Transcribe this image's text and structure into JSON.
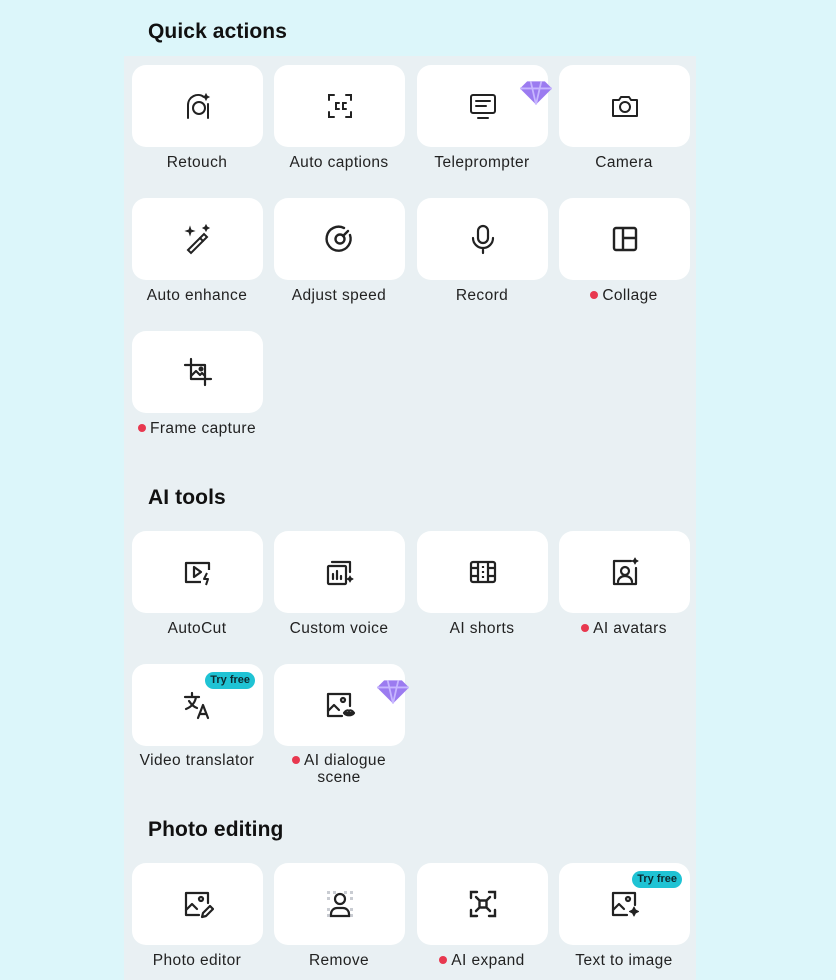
{
  "colors": {
    "background": "#dcf6fa",
    "panel": "#e9f0f3",
    "tile": "#ffffff",
    "new_dot": "#e8384f",
    "try_free_badge": "#1fc3d4",
    "premium_gem": "#9b7bf0"
  },
  "sections": {
    "quick_actions": {
      "title": "Quick actions",
      "items": [
        {
          "label": "Retouch",
          "icon": "retouch-face-icon"
        },
        {
          "label": "Auto captions",
          "icon": "captions-icon"
        },
        {
          "label": "Teleprompter",
          "icon": "teleprompter-icon",
          "badge": "premium"
        },
        {
          "label": "Camera",
          "icon": "camera-icon"
        },
        {
          "label": "Auto enhance",
          "icon": "magic-wand-icon"
        },
        {
          "label": "Adjust speed",
          "icon": "speed-dial-icon"
        },
        {
          "label": "Record",
          "icon": "microphone-icon"
        },
        {
          "label": "Collage",
          "icon": "collage-icon",
          "new": true
        },
        {
          "label": "Frame capture",
          "icon": "frame-crop-icon",
          "new": true
        }
      ]
    },
    "ai_tools": {
      "title": "AI tools",
      "items": [
        {
          "label": "AutoCut",
          "icon": "autocut-play-icon"
        },
        {
          "label": "Custom voice",
          "icon": "voice-waveform-icon"
        },
        {
          "label": "AI shorts",
          "icon": "film-strip-icon"
        },
        {
          "label": "AI avatars",
          "icon": "avatar-sparkle-icon",
          "new": true
        },
        {
          "label": "Video translator",
          "icon": "translate-icon",
          "badge_text": "Try free"
        },
        {
          "label": "AI dialogue scene",
          "label_line1": "AI dialogue",
          "label_line2": "scene",
          "icon": "image-lips-icon",
          "new": true,
          "badge": "premium"
        }
      ]
    },
    "photo_editing": {
      "title": "Photo editing",
      "items": [
        {
          "label": "Photo editor",
          "icon": "image-edit-icon"
        },
        {
          "label": "Remove",
          "icon": "remove-person-icon"
        },
        {
          "label": "AI expand",
          "icon": "expand-focus-icon",
          "new": true
        },
        {
          "label": "Text to image",
          "icon": "image-sparkle-icon",
          "badge_text": "Try free"
        }
      ]
    }
  }
}
